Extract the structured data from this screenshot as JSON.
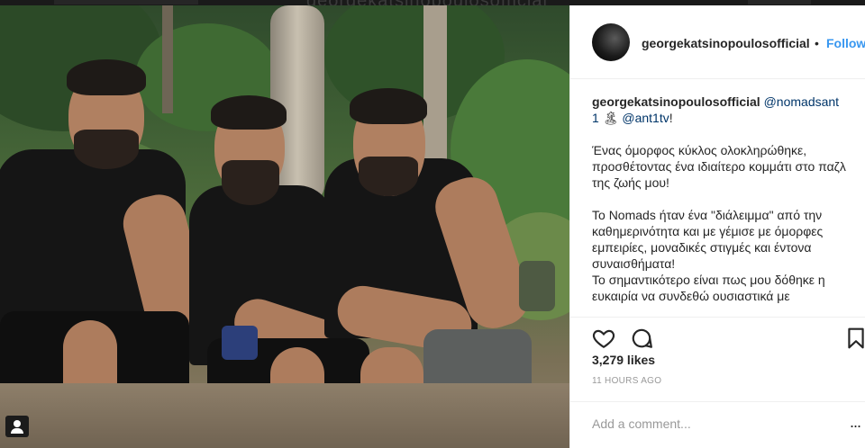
{
  "watermark": "georgekatsinopoulosofficial",
  "post": {
    "username": "georgekatsinopoulosofficial",
    "follow_dot": "•",
    "follow_label": "Follow",
    "caption": {
      "username": "georgekatsinopoulosofficial",
      "mention1": "@nomadsant",
      "mention1_cont": "1",
      "emoji": "🏝",
      "mention2": "@ant1tv",
      "after_mention2": "!",
      "para1": "Ένας όμορφος κύκλος ολοκληρώθηκε, προσθέτοντας ένα ιδιαίτερο κομμάτι στο παζλ της ζωής μου!",
      "para2": "Το Nomads ήταν ένα \"διάλειμμα\" από την καθημερινότητα και με γέμισε με όμορφες εμπειρίες, μοναδικές στιγμές και έντονα συναισθήματα!",
      "para3": "Το σημαντικότερο είναι πως μου δόθηκε η ευκαιρία να συνδεθώ ουσιαστικά με"
    },
    "likes": "3,279 likes",
    "timestamp": "11 HOURS AGO",
    "comment_placeholder": "Add a comment...",
    "more_label": "..."
  },
  "icons": {
    "like": "heart-icon",
    "comment": "comment-bubble-icon",
    "save": "bookmark-icon",
    "tagged": "user-tag-icon"
  }
}
